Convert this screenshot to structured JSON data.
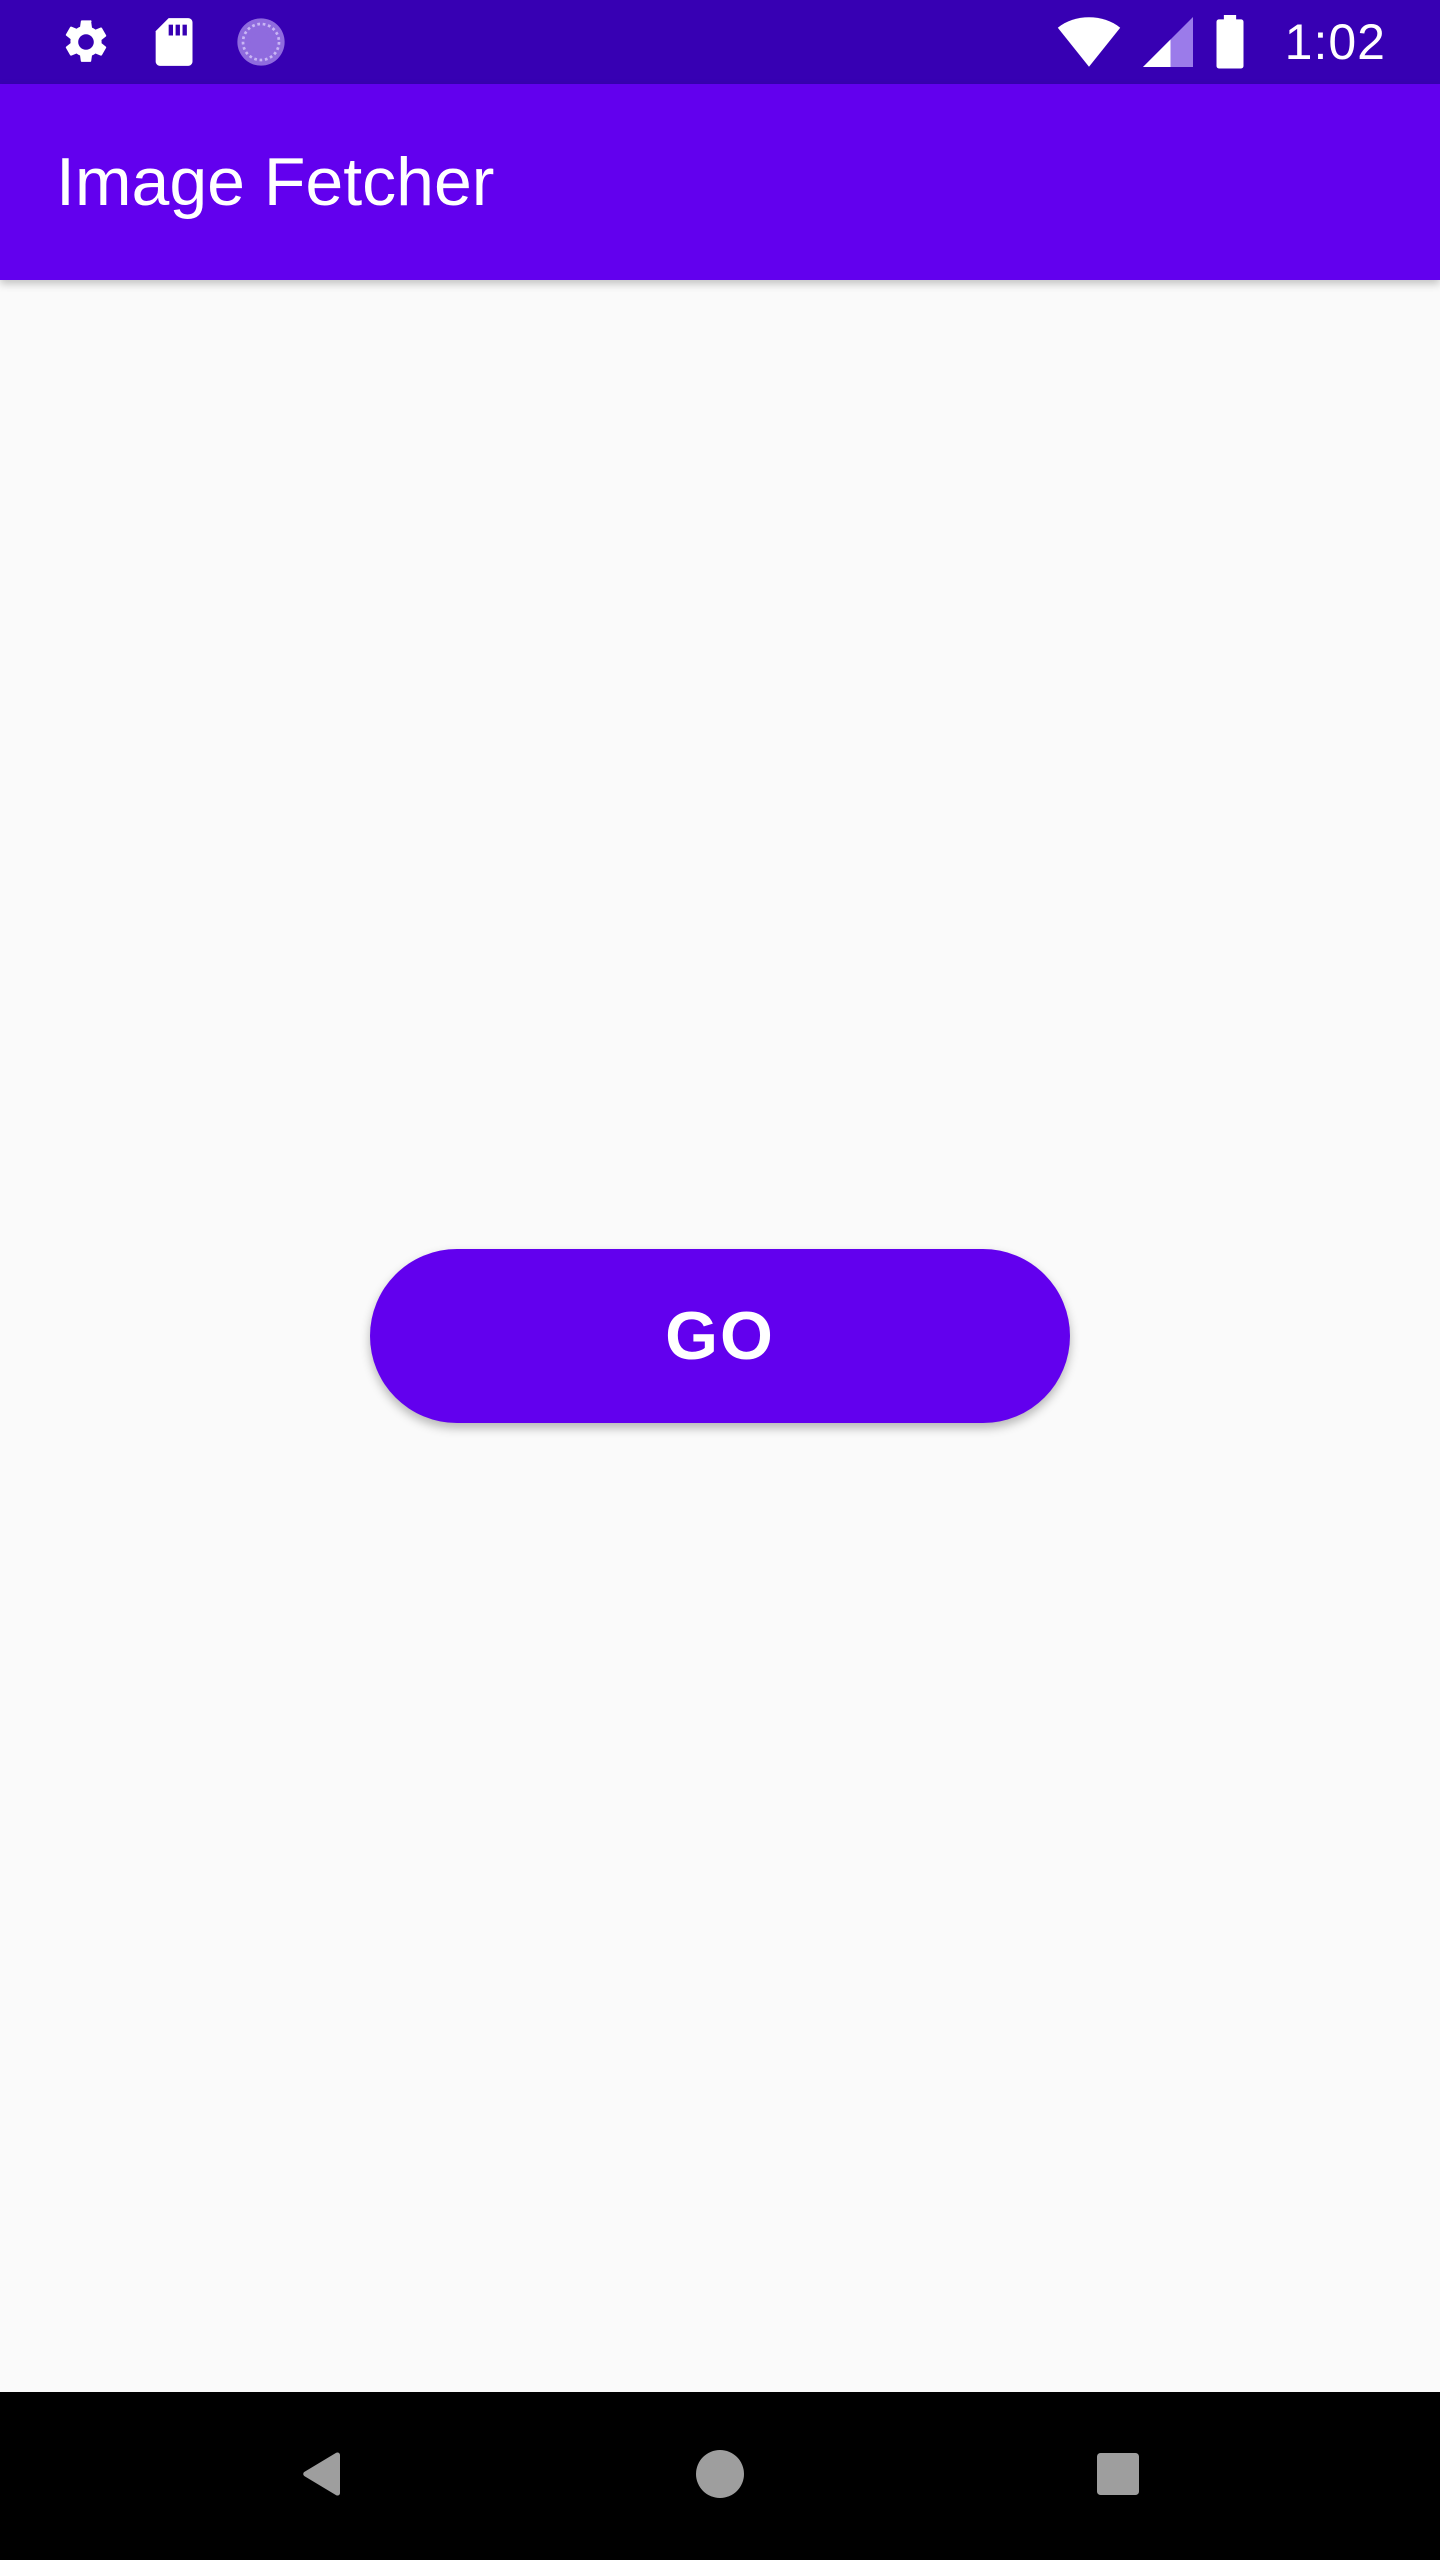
{
  "status_bar": {
    "time": "1:02",
    "left_icons": [
      "settings-icon",
      "sd-card-icon",
      "loading-icon"
    ],
    "right_icons": [
      "wifi-icon",
      "cell-signal-icon",
      "battery-icon"
    ],
    "background": "#3700b3"
  },
  "app_bar": {
    "title": "Image Fetcher",
    "background": "#6200ee"
  },
  "main": {
    "go_button_label": "GO",
    "button_color": "#6200ee",
    "background": "#fafafa"
  },
  "nav_bar": {
    "buttons": [
      "back-icon",
      "home-icon",
      "recents-icon"
    ],
    "background": "#000000"
  }
}
